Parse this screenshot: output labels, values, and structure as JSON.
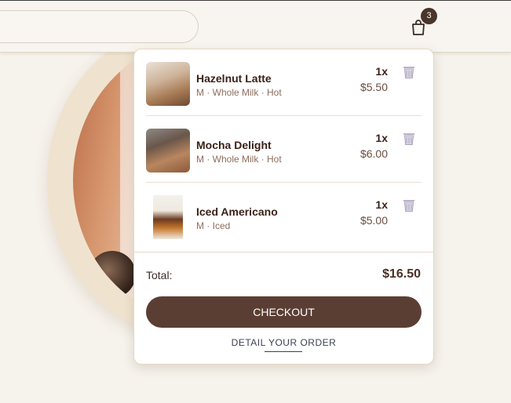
{
  "header": {
    "search_placeholder": "",
    "cart_count": "3"
  },
  "cart": {
    "items": [
      {
        "name": "Hazelnut Latte",
        "options": "M · Whole Milk · Hot",
        "qty": "1x",
        "price": "$5.50",
        "image": "hazelnut-latte-photo"
      },
      {
        "name": "Mocha Delight",
        "options": "M · Whole Milk · Hot",
        "qty": "1x",
        "price": "$6.00",
        "image": "mocha-delight-photo"
      },
      {
        "name": "Iced Americano",
        "options": "M · Iced",
        "qty": "1x",
        "price": "$5.00",
        "image": "iced-americano-photo"
      }
    ],
    "total_label": "Total:",
    "total_value": "$16.50",
    "checkout_label": "CHECKOUT",
    "detail_label": "DETAIL YOUR ORDER"
  },
  "icons": {
    "cart": "shopping-bag-icon",
    "remove": "trash-icon"
  },
  "colors": {
    "accent": "#5b3e33",
    "background": "#f6f2ec",
    "badge": "#4a352b"
  }
}
